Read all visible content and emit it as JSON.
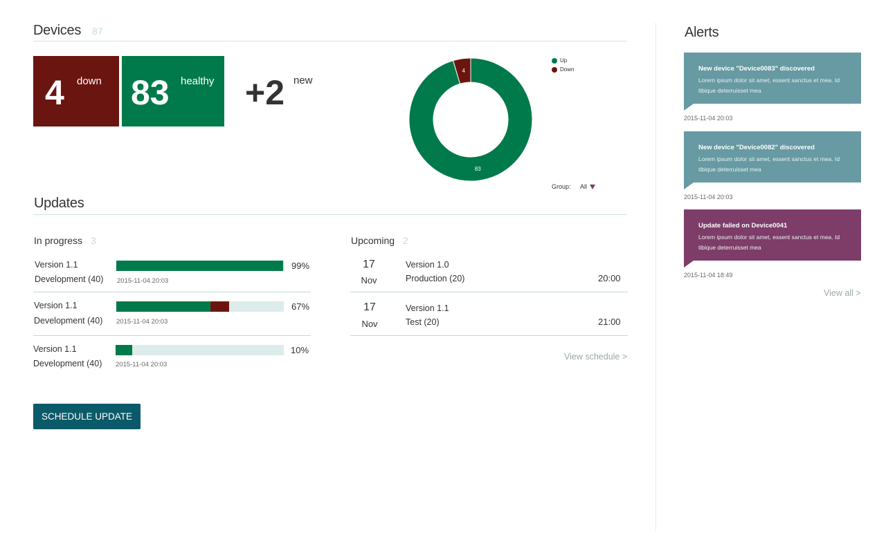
{
  "devices": {
    "title": "Devices",
    "count": "87",
    "down": {
      "value": "4",
      "label": "down"
    },
    "healthy": {
      "value": "83",
      "label": "healthy"
    },
    "new": {
      "value": "+2",
      "label": "new"
    },
    "colors": {
      "down": "#6b1510",
      "up": "#007a4a"
    }
  },
  "chart_data": {
    "type": "pie",
    "categories": [
      "Up",
      "Down"
    ],
    "values": [
      83,
      4
    ],
    "colors": [
      "#007a4a",
      "#6b1510"
    ],
    "slice_labels": [
      "83",
      "4"
    ],
    "legend_position": "top-right",
    "donut": true
  },
  "group_filter": {
    "label": "Group:",
    "value": "All"
  },
  "updates": {
    "title": "Updates",
    "in_progress": {
      "title": "In progress",
      "count": "3",
      "rows": [
        {
          "version": "Version 1.1",
          "target": "Development (40)",
          "date": "2015-11-04 20:03",
          "percent": "99%",
          "progress": 0.99,
          "failed": 0
        },
        {
          "version": "Version 1.1",
          "target": "Development (40)",
          "date": "2015-11-04 20:03",
          "percent": "67%",
          "progress": 0.67,
          "failed": 0.11
        },
        {
          "version": "Version 1.1",
          "target": "Development (40)",
          "date": "2015-11-04 20:03",
          "percent": "10%",
          "progress": 0.1,
          "failed": 0
        }
      ]
    },
    "upcoming": {
      "title": "Upcoming",
      "count": "2",
      "rows": [
        {
          "day": "17",
          "month": "Nov",
          "version": "Version 1.0",
          "target": "Production (20)",
          "time": "20:00"
        },
        {
          "day": "17",
          "month": "Nov",
          "version": "Version 1.1",
          "target": "Test (20)",
          "time": "21:00"
        }
      ],
      "view_schedule": "View schedule >"
    },
    "schedule_button": "SCHEDULE UPDATE"
  },
  "alerts": {
    "title": "Alerts",
    "items": [
      {
        "title": "New device \"Device0083\" discovered",
        "body": "Lorem ipsum dolor sit amet, essent sanctus et mea. Id tibique deterruisset mea",
        "time": "2015-11-04 20:03",
        "color": "#679aa3"
      },
      {
        "title": "New device \"Device0082\" discovered",
        "body": "Lorem ipsum dolor sit amet, essent sanctus et mea. Id tibique deterruisset mea",
        "time": "2015-11-04 20:03",
        "color": "#679aa3"
      },
      {
        "title": "Update failed on Device0041",
        "body": "Lorem ipsum dolor sit amet, essent sanctus et mea. Id tibique deterruisset mea",
        "time": "2015-11-04 18:49",
        "color": "#7d3d68"
      }
    ],
    "view_all": "View all >"
  }
}
